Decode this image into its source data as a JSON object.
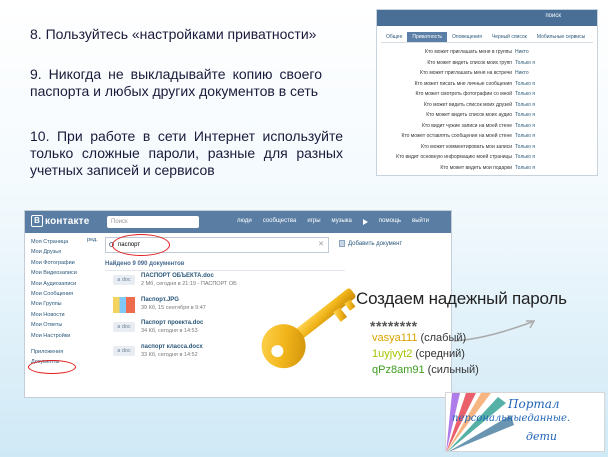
{
  "tips": {
    "tip8": "8. Пользуйтесь «настройками приватности»",
    "tip9": "9. Никогда не выкладывайте копию своего паспорта и любых других документов в сеть",
    "tip10": "10. При работе в сети Интернет используйте только сложные пароли, разные для разных учетных записей и сервисов"
  },
  "privacy": {
    "topbar_search": "поиск",
    "tabs": [
      {
        "label": "Общее",
        "active": false
      },
      {
        "label": "Приватность",
        "active": true
      },
      {
        "label": "Оповещения",
        "active": false
      },
      {
        "label": "Черный список",
        "active": false
      },
      {
        "label": "Мобильные сервисы",
        "active": false
      }
    ],
    "rows": [
      {
        "question": "Кто может приглашать меня в группы",
        "value": "Никто"
      },
      {
        "question": "Кто может видеть список моих групп",
        "value": "Только я"
      },
      {
        "question": "Кто может приглашать меня на встречи",
        "value": "Никто"
      },
      {
        "question": "Кто может писать мне личные сообщения",
        "value": "Только я"
      },
      {
        "question": "Кто может смотреть фотографии со мной",
        "value": "Только я"
      },
      {
        "question": "Кто может видеть список моих друзей",
        "value": "Только я"
      },
      {
        "question": "Кто может видеть список моих аудио",
        "value": "Только я"
      },
      {
        "question": "Кто видит чужие записи на моей стене",
        "value": "Только я"
      },
      {
        "question": "Кто может оставлять сообщения на моей стене",
        "value": "Только я"
      },
      {
        "question": "Кто может комментировать мои записи",
        "value": "Только я"
      },
      {
        "question": "Кто видит основную информацию моей страницы",
        "value": "Только я"
      },
      {
        "question": "Кто может видеть мои подарки",
        "value": "Только я"
      }
    ]
  },
  "vk": {
    "logo_letter": "В",
    "logo_text": "контакте",
    "search_placeholder": "Поиск",
    "nav": [
      "люди",
      "сообщества",
      "игры",
      "музыка",
      "помощь",
      "выйти"
    ],
    "edit_link": "ред.",
    "sidebar": [
      "Моя Страница",
      "Мои Друзья",
      "Мои Фотографии",
      "Мои Видеозаписи",
      "Мои Аудиозаписи",
      "Мои Сообщения",
      "Мои Группы",
      "Мои Новости",
      "Мои Ответы",
      "Мои Настройки",
      "Приложения",
      "Документы"
    ],
    "doc_search_value": "паспорт",
    "add_document": "Добавить документ",
    "found": "Найдено 9 090 документов",
    "docs": [
      {
        "ext": "a doc",
        "name": "ПАСПОРТ ОБЪЕКТА.doc",
        "meta": "2 Мб, сегодня в 21:19 - ПАСПОРТ ОБ",
        "thumb": false
      },
      {
        "ext": "",
        "name": "Паспорт.JPG",
        "meta": "39 Кб, 15 сентября в 9:47",
        "thumb": true
      },
      {
        "ext": "a doc",
        "name": "Паспорт проекта.doc",
        "meta": "34 Кб, сегодня в 14:53",
        "thumb": false
      },
      {
        "ext": "a doc",
        "name": "паспорт класса.docx",
        "meta": "33 Кб, сегодня в 14:52",
        "thumb": false
      }
    ]
  },
  "password": {
    "title": "Создаем надежный пароль",
    "stars": "********",
    "examples": [
      {
        "value": "vasya111",
        "level": "(слабый)",
        "color": "#d9a300"
      },
      {
        "value": "1uyjvyt2",
        "level": "(средний)",
        "color": "#a7c400"
      },
      {
        "value": "qPz8am91",
        "level": "(сильный)",
        "color": "#3c9d1e"
      }
    ]
  },
  "portal": {
    "line1": "Портал",
    "line2": "персональныеданные.",
    "line3": "дети"
  },
  "colors": {
    "vk_header": "#597da3",
    "vk_link": "#2b587a",
    "highlight_ring": "#e21d1d",
    "key_gold": "#f2b61c"
  }
}
